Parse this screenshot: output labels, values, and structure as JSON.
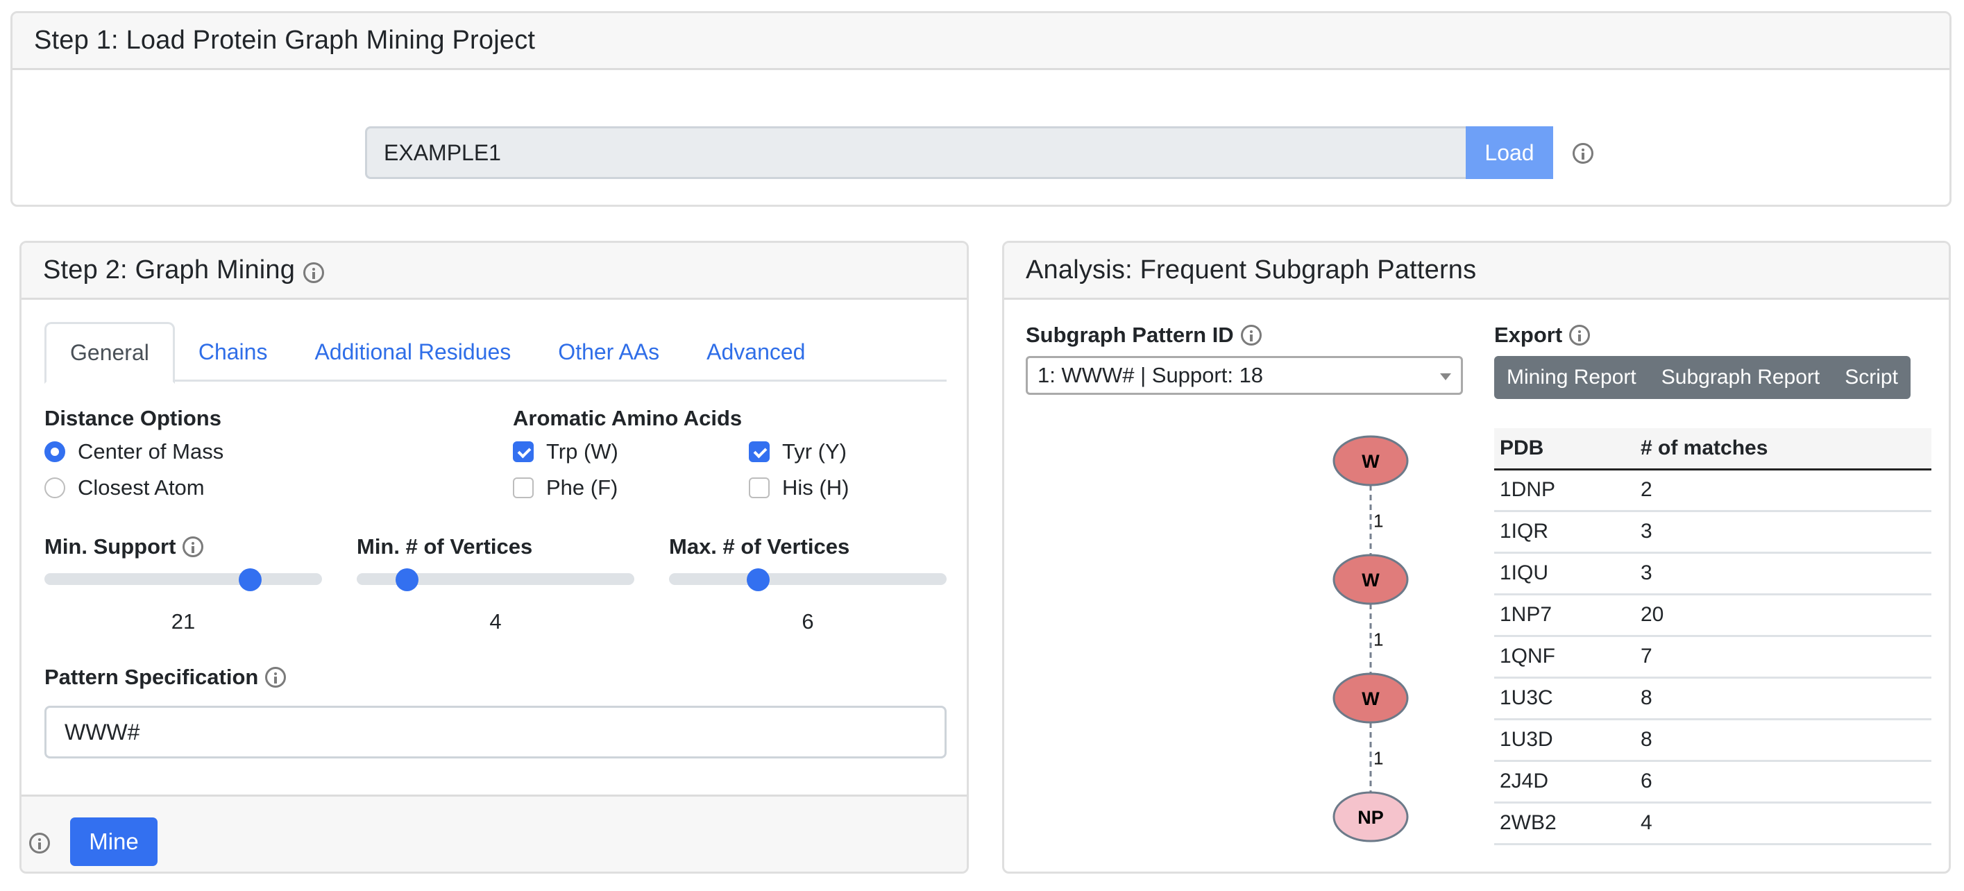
{
  "step1": {
    "title": "Step 1: Load Protein Graph Mining Project",
    "project_input_value": "EXAMPLE1",
    "load_label": "Load"
  },
  "step2": {
    "title": "Step 2: Graph Mining",
    "tabs": [
      {
        "label": "General",
        "active": true
      },
      {
        "label": "Chains",
        "active": false
      },
      {
        "label": "Additional Residues",
        "active": false
      },
      {
        "label": "Other AAs",
        "active": false
      },
      {
        "label": "Advanced",
        "active": false
      }
    ],
    "distance_options": {
      "label": "Distance Options",
      "options": [
        {
          "label": "Center of Mass",
          "checked": true
        },
        {
          "label": "Closest Atom",
          "checked": false
        }
      ]
    },
    "aromatic": {
      "label": "Aromatic Amino Acids",
      "options": [
        {
          "label": "Trp (W)",
          "checked": true
        },
        {
          "label": "Tyr (Y)",
          "checked": true
        },
        {
          "label": "Phe (F)",
          "checked": false
        },
        {
          "label": "His (H)",
          "checked": false
        }
      ]
    },
    "sliders": [
      {
        "label": "Min. Support",
        "value": "21",
        "fraction": 0.74,
        "has_info": true
      },
      {
        "label": "Min. # of Vertices",
        "value": "4",
        "fraction": 0.18,
        "has_info": false
      },
      {
        "label": "Max. # of Vertices",
        "value": "6",
        "fraction": 0.32,
        "has_info": false
      }
    ],
    "pattern_spec": {
      "label": "Pattern Specification",
      "value": "WWW#"
    },
    "mine_label": "Mine"
  },
  "analysis": {
    "title": "Analysis: Frequent Subgraph Patterns",
    "pattern_id_label": "Subgraph Pattern ID",
    "pattern_selected": "1: WWW# | Support: 18",
    "export_label": "Export",
    "export_buttons": [
      "Mining Report",
      "Subgraph Report",
      "Script"
    ],
    "graph": {
      "nodes": [
        {
          "label": "W",
          "color": "#e07c7b"
        },
        {
          "label": "W",
          "color": "#e07c7b"
        },
        {
          "label": "W",
          "color": "#e07c7b"
        },
        {
          "label": "NP",
          "color": "#f5c3cc"
        }
      ],
      "edges": [
        {
          "from": 0,
          "to": 1,
          "label": "1"
        },
        {
          "from": 1,
          "to": 2,
          "label": "1"
        },
        {
          "from": 2,
          "to": 3,
          "label": "1"
        }
      ]
    },
    "table": {
      "headers": [
        "PDB",
        "# of matches"
      ],
      "rows": [
        [
          "1DNP",
          "2"
        ],
        [
          "1IQR",
          "3"
        ],
        [
          "1IQU",
          "3"
        ],
        [
          "1NP7",
          "20"
        ],
        [
          "1QNF",
          "7"
        ],
        [
          "1U3C",
          "8"
        ],
        [
          "1U3D",
          "8"
        ],
        [
          "2J4D",
          "6"
        ],
        [
          "2WB2",
          "4"
        ]
      ]
    }
  },
  "colors": {
    "primary": "#3370f0",
    "primary_disabled": "#6ea0f7",
    "secondary": "#6c757d",
    "link": "#2f6ee8"
  }
}
